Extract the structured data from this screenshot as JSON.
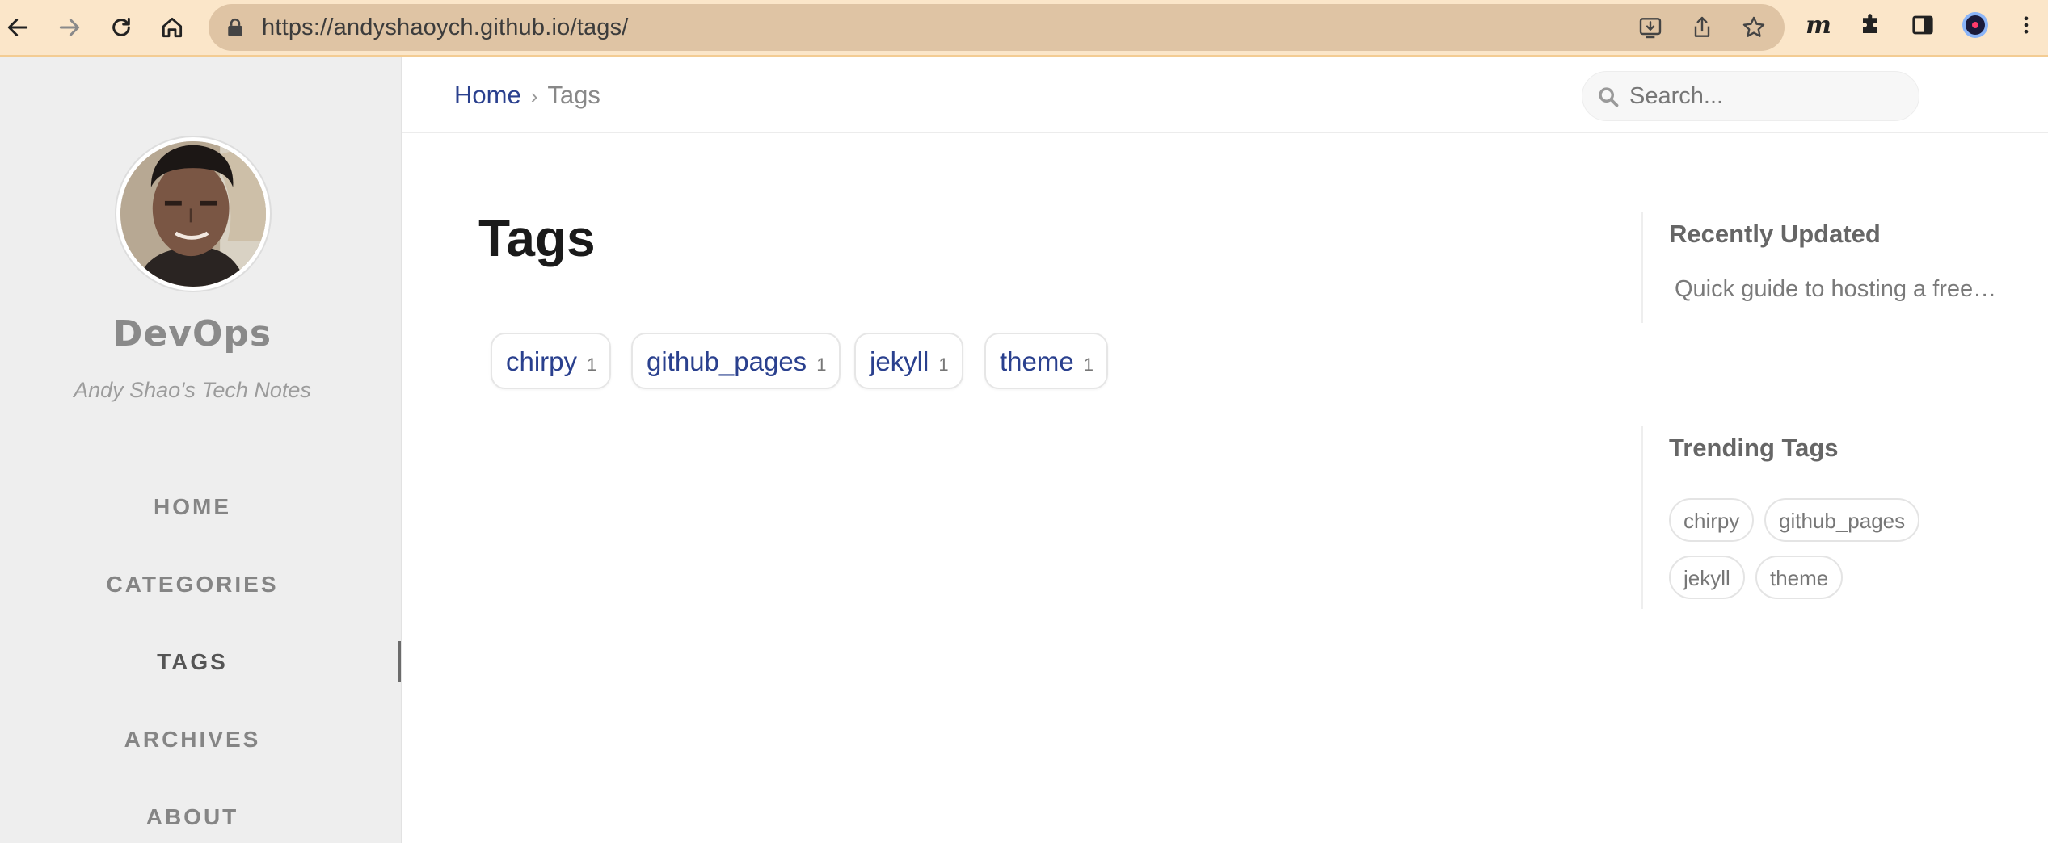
{
  "browser": {
    "url": "https://andyshaoych.github.io/tags/",
    "icons": {
      "back": "arrow-left-icon",
      "forward": "arrow-right-icon",
      "reload": "reload-icon",
      "home": "home-icon",
      "lock": "lock-icon",
      "install": "install-app-icon",
      "share": "share-icon",
      "bookmark": "star-icon",
      "extension_m": "m-extension-icon",
      "extensions": "puzzle-icon",
      "side_panel": "side-panel-icon",
      "profile": "profile-avatar-icon",
      "menu": "kebab-menu-icon"
    },
    "extension_m_label": "m",
    "colors": {
      "chrome_bg": "#fbe6c9",
      "omnibox_bg": "#dfc4a4"
    }
  },
  "sidebar": {
    "title": "DevOps",
    "subtitle": "Andy Shao's Tech Notes",
    "items": [
      {
        "label": "HOME",
        "active": false
      },
      {
        "label": "CATEGORIES",
        "active": false
      },
      {
        "label": "TAGS",
        "active": true
      },
      {
        "label": "ARCHIVES",
        "active": false
      },
      {
        "label": "ABOUT",
        "active": false
      }
    ]
  },
  "topbar": {
    "breadcrumb": {
      "home": "Home",
      "separator": "›",
      "current": "Tags"
    },
    "search": {
      "placeholder": "Search...",
      "value": ""
    }
  },
  "main": {
    "title": "Tags",
    "tags": [
      {
        "name": "chirpy",
        "count": "1"
      },
      {
        "name": "github_pages",
        "count": "1"
      },
      {
        "name": "jekyll",
        "count": "1"
      },
      {
        "name": "theme",
        "count": "1"
      }
    ]
  },
  "panel": {
    "recently_updated": {
      "heading": "Recently Updated",
      "items": [
        "Quick guide to hosting a free blog on GitHub Pages"
      ]
    },
    "trending": {
      "heading": "Trending Tags",
      "tags": [
        "chirpy",
        "github_pages",
        "jekyll",
        "theme"
      ]
    }
  },
  "colors": {
    "link": "#2a408e",
    "sidebar_bg": "#eeeeee"
  }
}
